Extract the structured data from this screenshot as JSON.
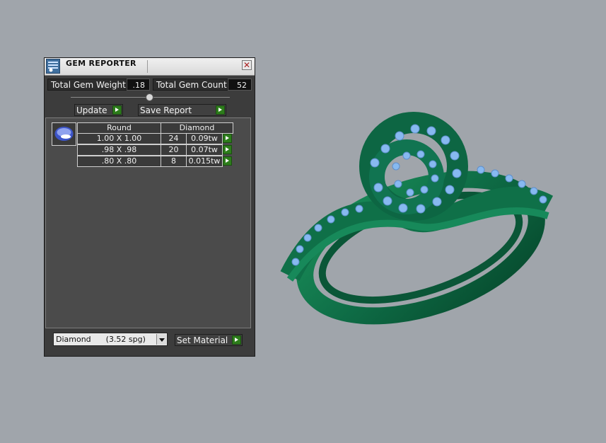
{
  "window": {
    "title": "GEM REPORTER",
    "close_symbol": "✕"
  },
  "totals": {
    "weight_label": "Total Gem Weight",
    "weight_value": ".18",
    "count_label": "Total Gem Count",
    "count_value": "52"
  },
  "buttons": {
    "update": "Update",
    "save_report": "Save Report",
    "set_material": "Set Material"
  },
  "table": {
    "headers": [
      "Round",
      "Diamond"
    ],
    "rows": [
      {
        "size": "1.00 X 1.00",
        "count": "24",
        "weight": "0.09tw"
      },
      {
        "size": ".98 X .98",
        "count": "20",
        "weight": "0.07tw"
      },
      {
        "size": ".80 X .80",
        "count": "8",
        "weight": "0.015tw"
      }
    ]
  },
  "material": {
    "selected": "Diamond      (3.52 spg)"
  },
  "colors": {
    "ring": "#0e6b45",
    "gems": "#87b9f0",
    "panel": "#3c3c3c",
    "go_button": "#2d7d1b"
  }
}
